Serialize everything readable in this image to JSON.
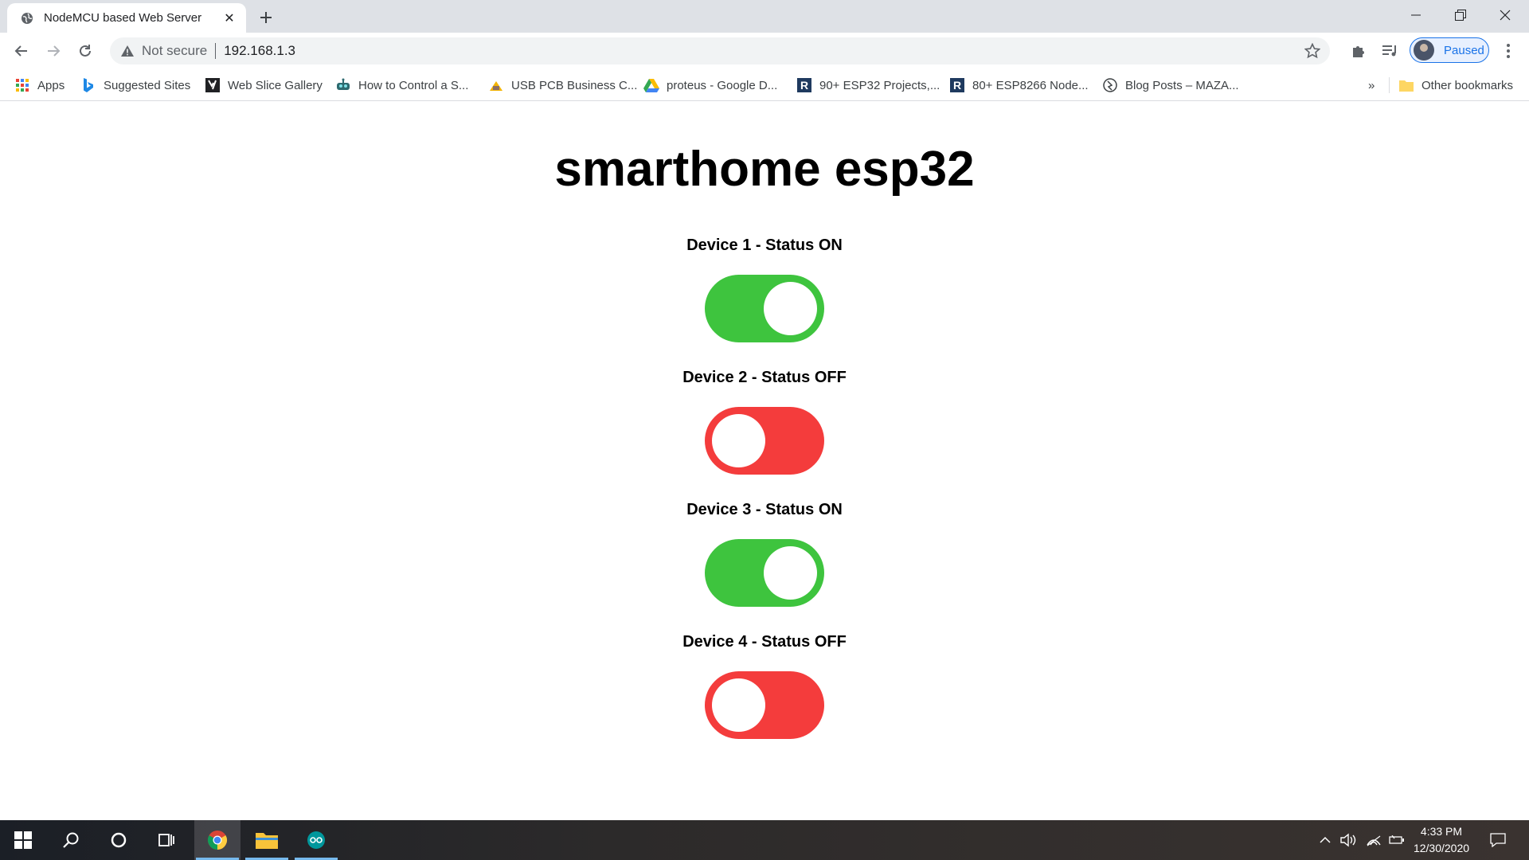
{
  "browser": {
    "tab": {
      "title": "NodeMCU based Web Server"
    },
    "omnibox": {
      "security_label": "Not secure",
      "url": "192.168.1.3"
    },
    "profile": {
      "label": "Paused"
    },
    "bookmarks": [
      {
        "label": "Apps",
        "icon": "apps-grid-icon"
      },
      {
        "label": "Suggested Sites",
        "icon": "bing-icon"
      },
      {
        "label": "Web Slice Gallery",
        "icon": "web-slice-icon"
      },
      {
        "label": "How to Control a S...",
        "icon": "robot-icon"
      },
      {
        "label": "USB PCB Business C...",
        "icon": "pcb-icon"
      },
      {
        "label": "proteus - Google D...",
        "icon": "google-drive-icon"
      },
      {
        "label": "90+ ESP32 Projects,...",
        "icon": "r-icon"
      },
      {
        "label": "80+ ESP8266 Node...",
        "icon": "r-icon"
      },
      {
        "label": "Blog Posts – MAZA...",
        "icon": "blog-icon"
      }
    ],
    "bookmarks_overflow": "»",
    "other_bookmarks": "Other bookmarks"
  },
  "page": {
    "title": "smarthome esp32",
    "devices": [
      {
        "label": "Device 1 - Status ON",
        "state": "on"
      },
      {
        "label": "Device 2 - Status OFF",
        "state": "off"
      },
      {
        "label": "Device 3 - Status ON",
        "state": "on"
      },
      {
        "label": "Device 4 - Status OFF",
        "state": "off"
      }
    ],
    "colors": {
      "on": "#3ec43e",
      "off": "#f43c3c"
    }
  },
  "taskbar": {
    "time": "4:33 PM",
    "date": "12/30/2020"
  }
}
